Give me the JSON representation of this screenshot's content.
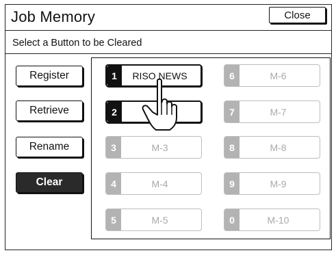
{
  "header": {
    "title": "Job Memory",
    "close_label": "Close"
  },
  "instruction": "Select a Button to be Cleared",
  "side_buttons": {
    "register": "Register",
    "retrieve": "Retrieve",
    "rename": "Rename",
    "clear": "Clear"
  },
  "slots": [
    {
      "number": "1",
      "name": "RISO NEWS",
      "enabled": true
    },
    {
      "number": "2",
      "name": "",
      "enabled": true
    },
    {
      "number": "3",
      "name": "M-3",
      "enabled": false
    },
    {
      "number": "4",
      "name": "M-4",
      "enabled": false
    },
    {
      "number": "5",
      "name": "M-5",
      "enabled": false
    },
    {
      "number": "6",
      "name": "M-6",
      "enabled": false
    },
    {
      "number": "7",
      "name": "M-7",
      "enabled": false
    },
    {
      "number": "8",
      "name": "M-8",
      "enabled": false
    },
    {
      "number": "9",
      "name": "M-9",
      "enabled": false
    },
    {
      "number": "0",
      "name": "M-10",
      "enabled": false
    }
  ],
  "icons": {
    "pointer": "hand-pointer-icon"
  },
  "colors": {
    "selected": "#111111",
    "disabled": "#b3b3b3",
    "active_button": "#2a2a2a"
  }
}
